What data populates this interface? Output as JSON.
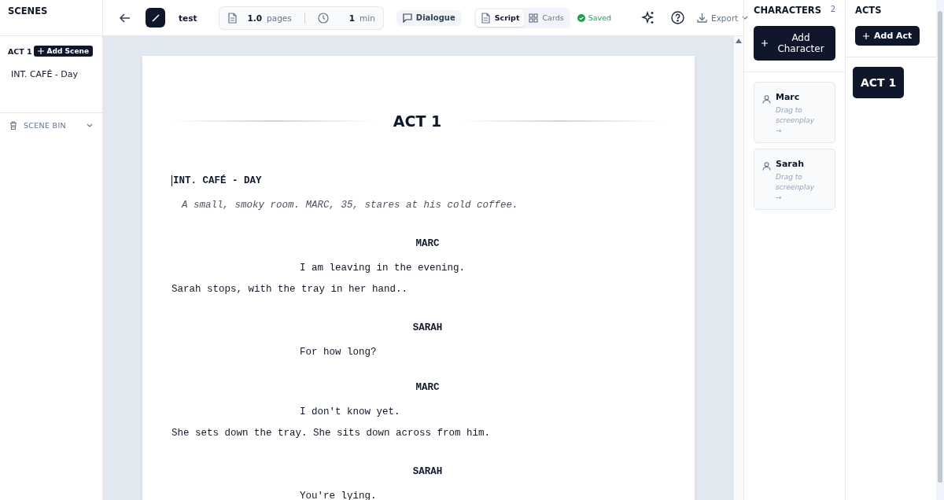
{
  "scenes_panel": {
    "title": "SCENES",
    "act_label": "ACT 1",
    "add_scene": "Add Scene",
    "scenes": [
      {
        "label": "INT. CAFÉ - Day"
      }
    ],
    "scene_bin": {
      "label": "SCENE BIN",
      "expanded": false
    }
  },
  "toolbar": {
    "title": "test",
    "pages": "1.0",
    "pages_unit": "pages",
    "minutes": "1",
    "minutes_unit": "min",
    "dialogue": "Dialogue",
    "views": [
      {
        "label": "Script",
        "selected": true
      },
      {
        "label": "Cards",
        "selected": false
      }
    ],
    "saved": "Saved",
    "export": "Export"
  },
  "document": {
    "act_title": "ACT 1",
    "lines": [
      {
        "kind": "heading",
        "text": "INT. CAFÉ - DAY"
      },
      {
        "kind": "description",
        "text": "A small, smoky room. MARC, 35, stares at his cold coffee."
      },
      {
        "kind": "character",
        "text": "MARC"
      },
      {
        "kind": "dialogue",
        "text": "I am leaving in the evening."
      },
      {
        "kind": "action",
        "text": "Sarah stops, with the tray in her hand.."
      },
      {
        "kind": "character",
        "text": "SARAH"
      },
      {
        "kind": "dialogue",
        "text": "For how long?"
      },
      {
        "kind": "character",
        "text": "MARC"
      },
      {
        "kind": "dialogue",
        "text": "I don't know yet."
      },
      {
        "kind": "action",
        "text": "She sets down the tray. She sits down across from him."
      },
      {
        "kind": "character",
        "text": "SARAH"
      },
      {
        "kind": "dialogue",
        "text": "You're lying."
      }
    ]
  },
  "characters_panel": {
    "title": "CHARACTERS",
    "count": "2",
    "add": "Add Character",
    "characters": [
      {
        "name": "Marc",
        "hint": "Drag to screenplay →"
      },
      {
        "name": "Sarah",
        "hint": "Drag to screenplay →"
      }
    ]
  },
  "acts_panel": {
    "title": "ACTS",
    "add": "Add Act",
    "acts": [
      {
        "label": "ACT 1"
      }
    ]
  }
}
